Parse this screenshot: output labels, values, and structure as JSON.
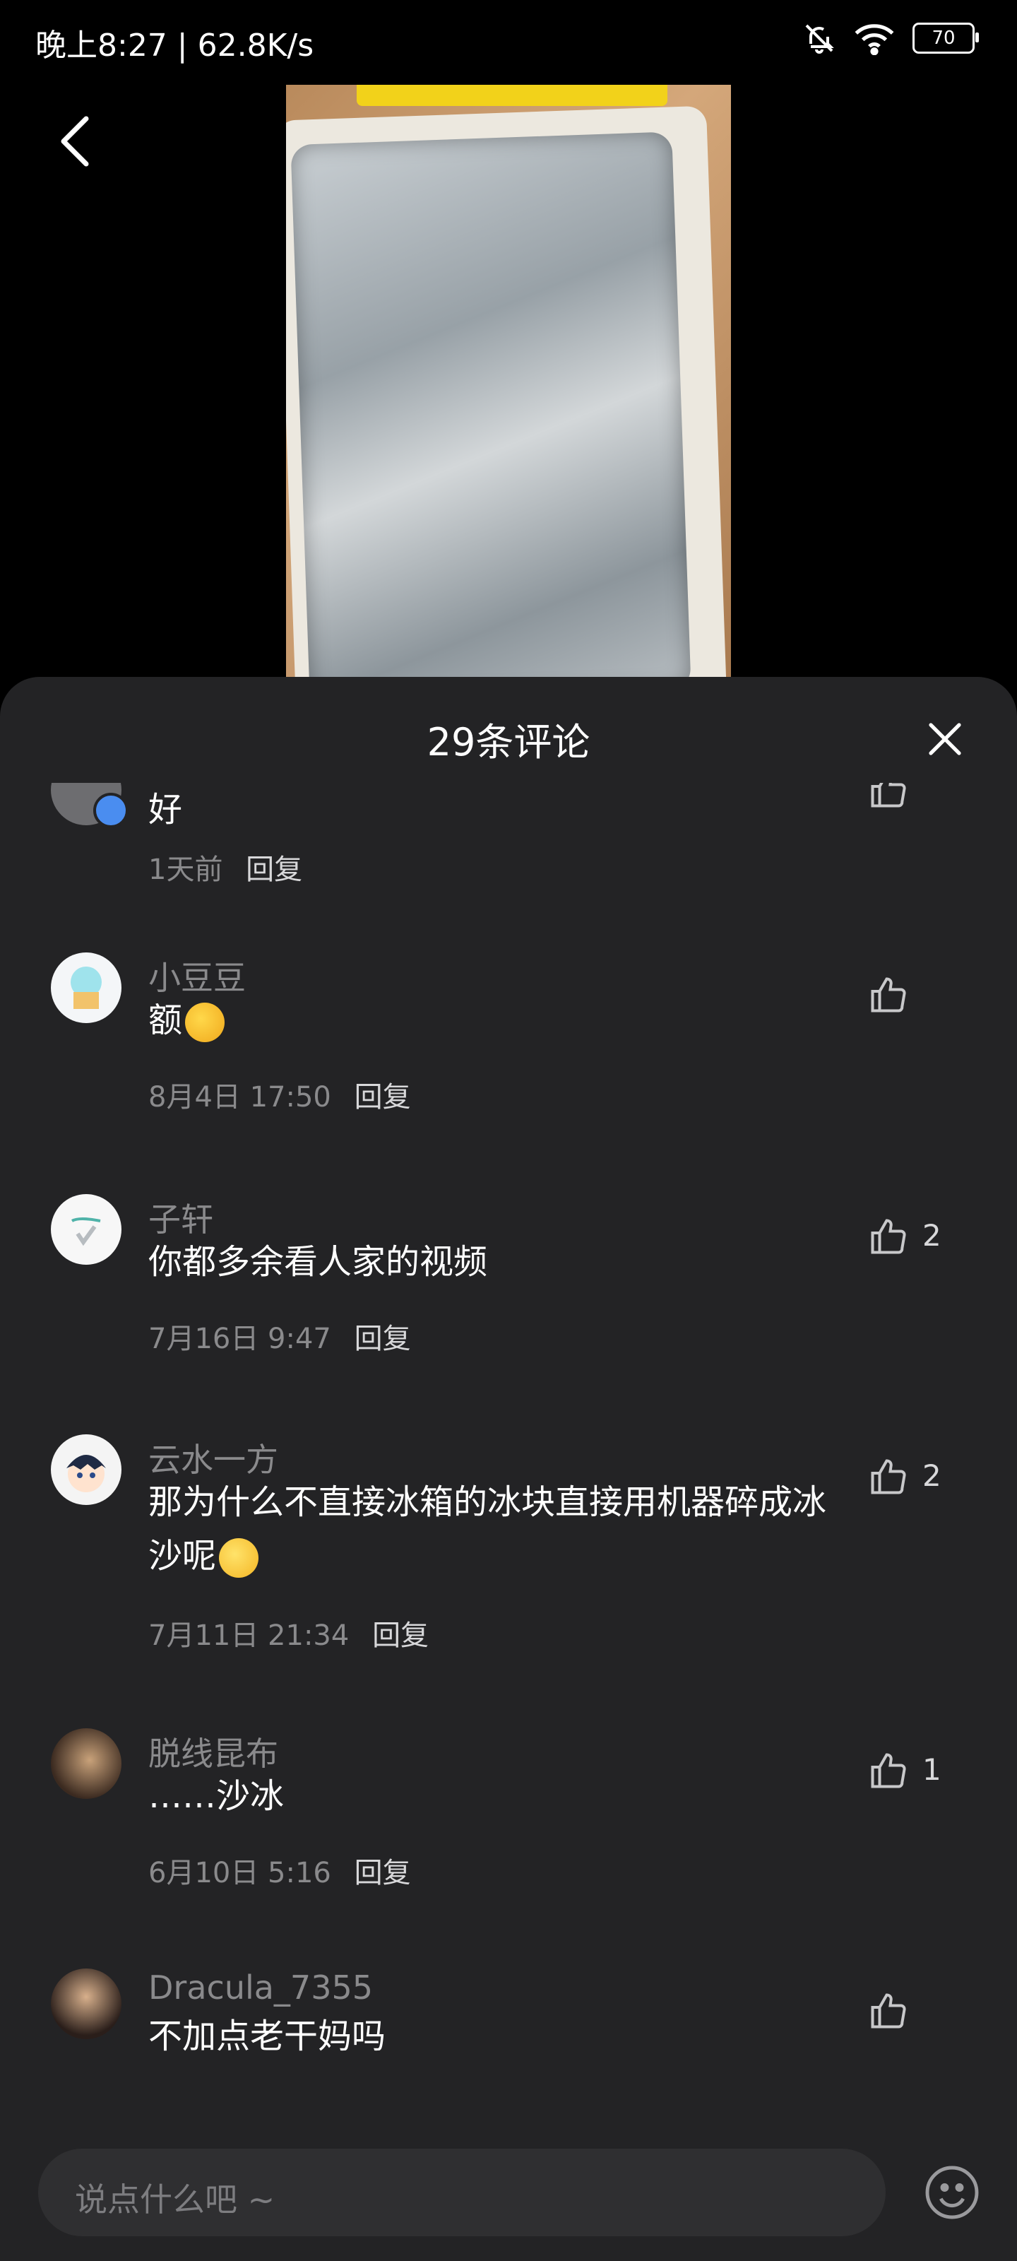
{
  "status_bar": {
    "time_speed": "晚上8:27 | 62.8K/s",
    "battery": "70"
  },
  "header": {
    "title": "29条评论"
  },
  "comments": [
    {
      "text": "好",
      "time": "1天前",
      "reply": "回复"
    },
    {
      "username": "小豆豆",
      "text": "额",
      "time": "8月4日  17:50",
      "reply": "回复"
    },
    {
      "username": "子轩",
      "text": "你都多余看人家的视频",
      "time": "7月16日  9:47",
      "reply": "回复",
      "likes": "2"
    },
    {
      "username": "云水一方",
      "text": "那为什么不直接冰箱的冰块直接用机器碎成冰沙呢",
      "time": "7月11日  21:34",
      "reply": "回复",
      "likes": "2"
    },
    {
      "username": "脱线昆布",
      "text": "……沙冰",
      "time": "6月10日  5:16",
      "reply": "回复",
      "likes": "1"
    },
    {
      "username": "Dracula_7355",
      "text": "不加点老干妈吗"
    }
  ],
  "input": {
    "placeholder": "说点什么吧 ~"
  },
  "icons": {
    "back": "chevron-left-icon",
    "close": "close-icon",
    "like": "thumb-up-icon",
    "emoji": "smiley-icon",
    "mute": "bell-off-icon",
    "wifi": "wifi-icon"
  }
}
